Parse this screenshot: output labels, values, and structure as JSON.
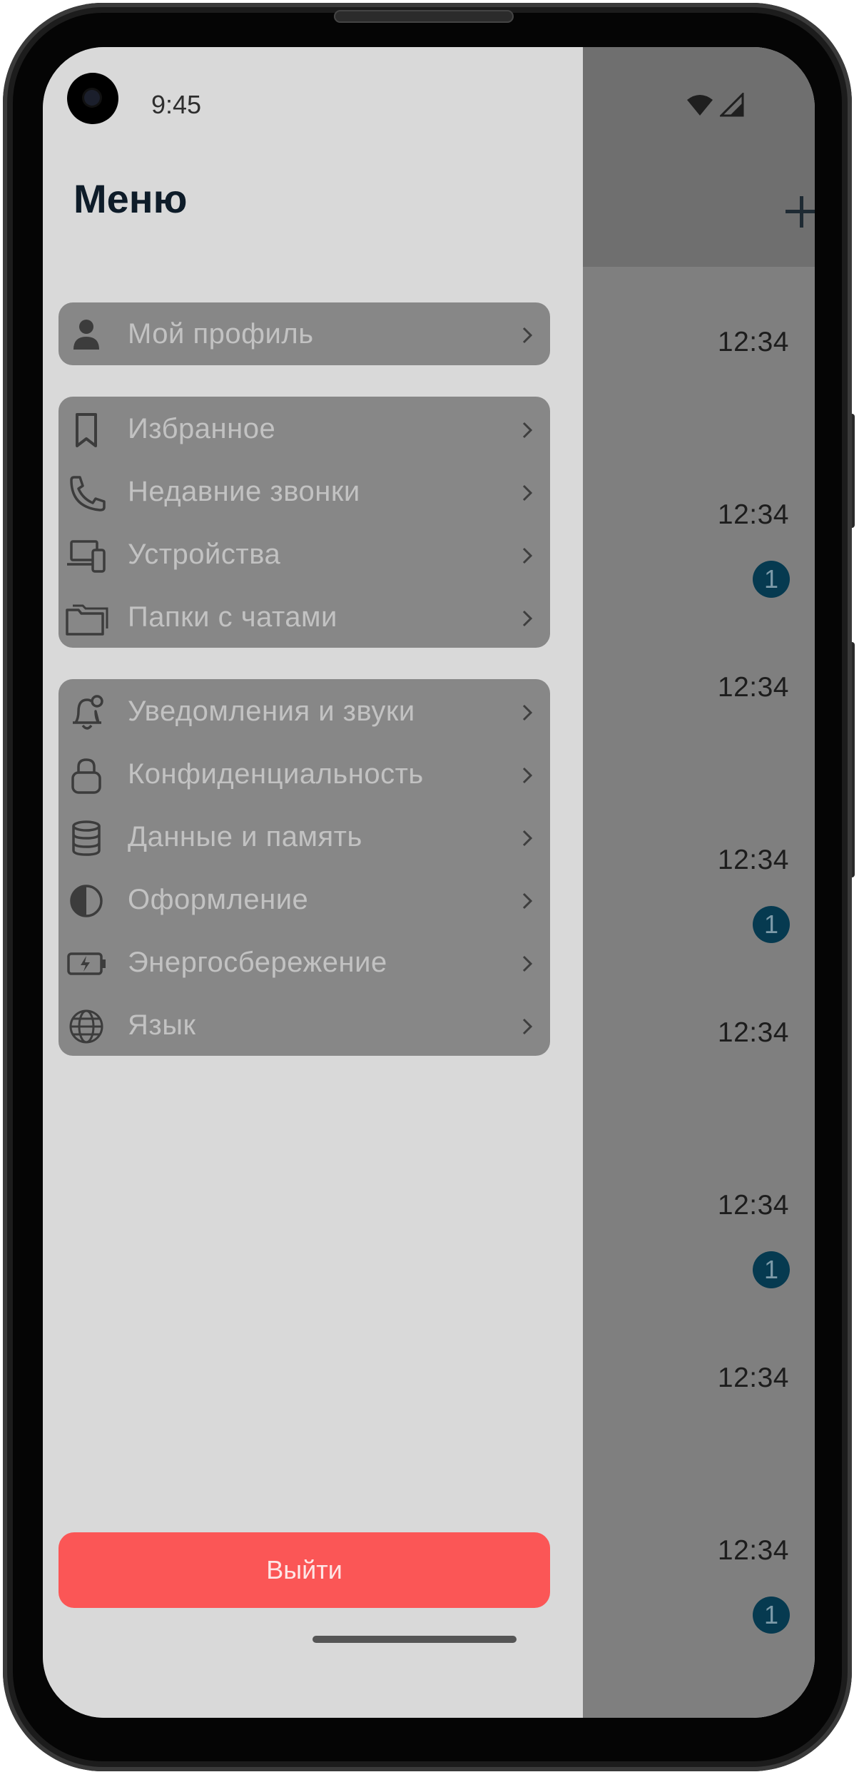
{
  "status_bar": {
    "time": "9:45"
  },
  "drawer": {
    "title": "Меню",
    "groups": [
      {
        "items": [
          {
            "label": "Мой профиль",
            "icon": "person-icon"
          }
        ]
      },
      {
        "items": [
          {
            "label": "Избранное",
            "icon": "bookmark-icon"
          },
          {
            "label": "Недавние звонки",
            "icon": "phone-icon"
          },
          {
            "label": "Устройства",
            "icon": "devices-icon"
          },
          {
            "label": "Папки с чатами",
            "icon": "folders-icon"
          }
        ]
      },
      {
        "items": [
          {
            "label": "Уведомления и звуки",
            "icon": "bell-icon"
          },
          {
            "label": "Конфиденциальность",
            "icon": "lock-icon"
          },
          {
            "label": "Данные и память",
            "icon": "database-icon"
          },
          {
            "label": "Оформление",
            "icon": "contrast-icon"
          },
          {
            "label": "Энергосбережение",
            "icon": "battery-icon"
          },
          {
            "label": "Язык",
            "icon": "globe-icon"
          }
        ]
      }
    ],
    "logout_label": "Выйти"
  },
  "chat_list": {
    "items": [
      {
        "time": "12:34",
        "badge": ""
      },
      {
        "time": "12:34",
        "badge": "1"
      },
      {
        "time": "12:34",
        "badge": ""
      },
      {
        "time": "12:34",
        "badge": "1"
      },
      {
        "time": "12:34",
        "badge": ""
      },
      {
        "time": "12:34",
        "badge": "1"
      },
      {
        "time": "12:34",
        "badge": ""
      },
      {
        "time": "12:34",
        "badge": "1"
      }
    ]
  },
  "colors": {
    "drawer_bg": "#d9d9d9",
    "card_bg": "#878787",
    "logout_bg": "#fb5656",
    "badge_bg": "#063a50",
    "title": "#0e1c29"
  }
}
